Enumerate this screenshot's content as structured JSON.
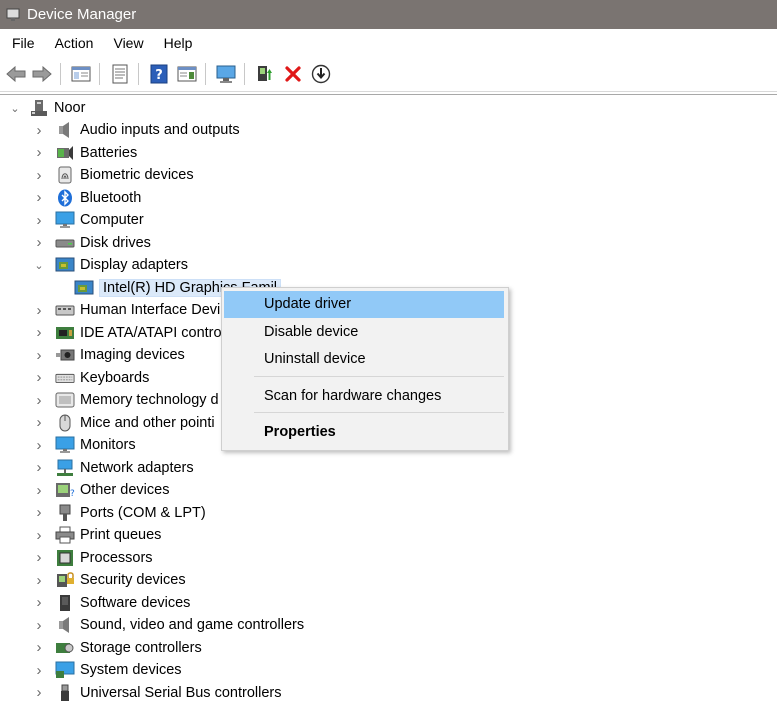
{
  "window": {
    "title": "Device Manager"
  },
  "menubar": {
    "items": [
      "File",
      "Action",
      "View",
      "Help"
    ]
  },
  "tree": {
    "root": "Noor",
    "items": [
      {
        "label": "Audio inputs and outputs",
        "icon": "speaker-icon"
      },
      {
        "label": "Batteries",
        "icon": "battery-icon"
      },
      {
        "label": "Biometric devices",
        "icon": "fingerprint-icon"
      },
      {
        "label": "Bluetooth",
        "icon": "bluetooth-icon"
      },
      {
        "label": "Computer",
        "icon": "computer-icon"
      },
      {
        "label": "Disk drives",
        "icon": "disk-drive-icon"
      },
      {
        "label": "Display adapters",
        "icon": "display-adapter-icon",
        "expanded": true
      },
      {
        "label": "Intel(R) HD Graphics Famil",
        "icon": "display-adapter-icon",
        "child": true
      },
      {
        "label": "Human Interface Devi",
        "icon": "hid-icon"
      },
      {
        "label": "IDE ATA/ATAPI controll",
        "icon": "ide-controller-icon"
      },
      {
        "label": "Imaging devices",
        "icon": "camera-icon"
      },
      {
        "label": "Keyboards",
        "icon": "keyboard-icon"
      },
      {
        "label": "Memory technology d",
        "icon": "memory-icon"
      },
      {
        "label": "Mice and other pointi",
        "icon": "mouse-icon"
      },
      {
        "label": "Monitors",
        "icon": "monitor-icon"
      },
      {
        "label": "Network adapters",
        "icon": "network-adapter-icon"
      },
      {
        "label": "Other devices",
        "icon": "other-devices-icon"
      },
      {
        "label": "Ports (COM & LPT)",
        "icon": "port-icon"
      },
      {
        "label": "Print queues",
        "icon": "printer-icon"
      },
      {
        "label": "Processors",
        "icon": "processor-icon"
      },
      {
        "label": "Security devices",
        "icon": "security-device-icon"
      },
      {
        "label": "Software devices",
        "icon": "software-device-icon"
      },
      {
        "label": "Sound, video and game controllers",
        "icon": "sound-controller-icon"
      },
      {
        "label": "Storage controllers",
        "icon": "storage-controller-icon"
      },
      {
        "label": "System devices",
        "icon": "system-devices-icon"
      },
      {
        "label": "Universal Serial Bus controllers",
        "icon": "usb-icon"
      }
    ]
  },
  "context_menu": {
    "items": [
      "Update driver",
      "Disable device",
      "Uninstall device",
      "Scan for hardware changes",
      "Properties"
    ]
  },
  "colors": {
    "titlebar": "#7a7471",
    "menu_highlight": "#91c9f7",
    "selection": "#dbe9f9"
  }
}
